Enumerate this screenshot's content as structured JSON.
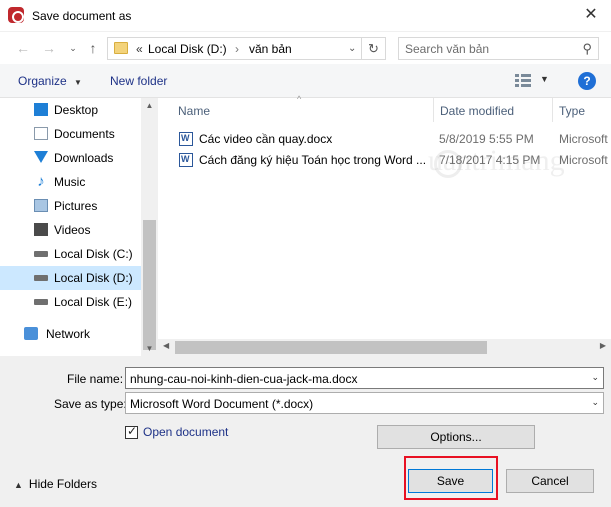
{
  "window": {
    "title": "Save document as",
    "close_label": "✕"
  },
  "nav": {
    "back_icon": "←",
    "forward_icon": "→",
    "recent_icon": "⌄",
    "up_icon": "↑",
    "breadcrumb_overflow": "«",
    "breadcrumb": [
      "Local Disk (D:)",
      "văn bản"
    ],
    "breadcrumb_separator": "›",
    "address_dropdown": "⌄",
    "refresh_icon": "↻",
    "search_placeholder": "Search văn bản",
    "search_icon": "⚲"
  },
  "toolbar": {
    "organize_label": "Organize",
    "organize_caret": "▼",
    "new_folder_label": "New folder",
    "view_caret": "▼",
    "help_label": "?"
  },
  "sidebar": {
    "items": [
      {
        "label": "Desktop",
        "icon": "desktop-icon",
        "color": "#1e7fd6"
      },
      {
        "label": "Documents",
        "icon": "documents-icon",
        "color": "#8a9aab"
      },
      {
        "label": "Downloads",
        "icon": "downloads-icon",
        "color": "#1e7fd6"
      },
      {
        "label": "Music",
        "icon": "music-icon",
        "color": "#1e7fd6"
      },
      {
        "label": "Pictures",
        "icon": "pictures-icon",
        "color": "#6a8eb3"
      },
      {
        "label": "Videos",
        "icon": "videos-icon",
        "color": "#4a4a4a"
      },
      {
        "label": "Local Disk (C:)",
        "icon": "drive-icon",
        "color": "#6f6f6f"
      },
      {
        "label": "Local Disk (D:)",
        "icon": "drive-icon",
        "color": "#6f6f6f",
        "selected": true
      },
      {
        "label": "Local Disk (E:)",
        "icon": "drive-icon",
        "color": "#6f6f6f"
      }
    ],
    "network_label": "Network"
  },
  "files": {
    "columns": [
      "Name",
      "Date modified",
      "Type"
    ],
    "sort_caret": "^",
    "rows": [
      {
        "name": "Các video cần quay.docx",
        "date": "5/8/2019 5:55 PM",
        "type": "Microsoft"
      },
      {
        "name": "Cách đăng ký hiệu Toán học trong Word ...",
        "date": "7/18/2017 4:15 PM",
        "type": "Microsoft"
      }
    ],
    "watermark": "uantrimang"
  },
  "form": {
    "file_name_label": "File name:",
    "file_name_value": "nhung-cau-noi-kinh-dien-cua-jack-ma.docx",
    "save_as_type_label": "Save as type:",
    "save_as_type_value": "Microsoft Word Document (*.docx)",
    "open_document_label": "Open document",
    "open_document_checked": true,
    "options_label": "Options...",
    "hide_folders_label": "Hide Folders",
    "hide_folders_caret": "▲",
    "save_label": "Save",
    "cancel_label": "Cancel",
    "dropdown_caret": "⌄"
  },
  "colors": {
    "accent": "#0078d7",
    "selection": "#cce8ff",
    "highlight_box": "#e81123",
    "link": "#1e3287"
  }
}
